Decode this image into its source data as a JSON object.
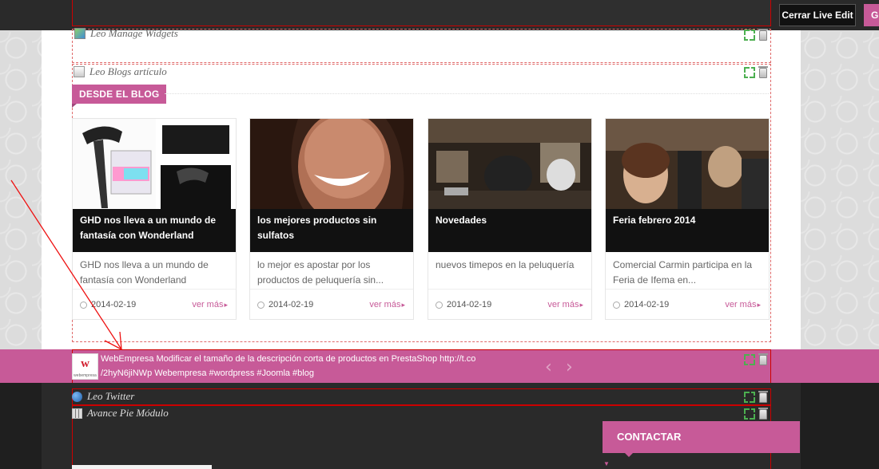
{
  "toolbar": {
    "close_live_edit_label": "Cerrar Live Edit",
    "pink_button_label": "G"
  },
  "modules": {
    "manage_widgets_title": "Leo Manage Widgets",
    "blogs_title": "Leo Blogs artículo",
    "twitter_title": "Leo Twitter",
    "footer_title": "Avance Pie Módulo"
  },
  "blog": {
    "section_label": "DESDE EL BLOG",
    "posts": [
      {
        "title": "GHD nos lleva a un mundo de fantasía con Wonderland",
        "description": "GHD nos lleva a un mundo de fantasía con Wonderland",
        "date": "2014-02-19",
        "more_label": "ver más"
      },
      {
        "title": "los mejores productos sin sulfatos",
        "description": "lo mejor es apostar por los productos de peluquería sin...",
        "date": "2014-02-19",
        "more_label": "ver más"
      },
      {
        "title": "Novedades",
        "description": "nuevos timepos en la peluquería",
        "date": "2014-02-19",
        "more_label": "ver más"
      },
      {
        "title": "Feria febrero 2014",
        "description": "Comercial Carmin participa en la Feria de Ifema en...",
        "date": "2014-02-19",
        "more_label": "ver más"
      }
    ]
  },
  "tweet": {
    "text_line1": "WebEmpresa Modificar el tamaño de la descripción corta de productos en PrestaShop http://t.co",
    "text_line2": "/2hyN6jiNWp Webempresa #wordpress #Joomla #blog",
    "logo_text": "w",
    "logo_caption": "webempresa",
    "prev_label": "‹",
    "next_label": "›"
  },
  "footer": {
    "contact_label": "CONTACTAR"
  },
  "colors": {
    "accent": "#c75a98",
    "dark": "#1f1f1f",
    "edit_outline": "#cc0000"
  }
}
